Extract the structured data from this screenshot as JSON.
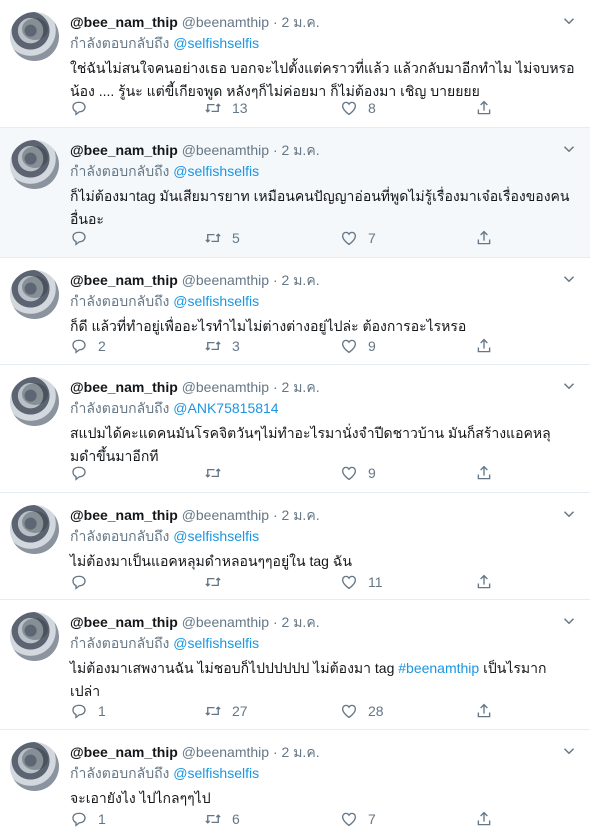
{
  "colors": {
    "link": "#1b95e0",
    "muted": "#657786",
    "text": "#14171a",
    "alt_bg": "#f5f8fa"
  },
  "tweets": [
    {
      "name": "@bee_nam_thip",
      "handle": "@beenamthip",
      "sep": "·",
      "date": "2 ม.ค.",
      "reply_prefix": "กำลังตอบกลับถึง",
      "reply_to": "@selfishselfis",
      "text": "ใช่ฉันไม่สนใจคนอย่างเธอ บอกจะไปตั้งแต่คราวที่แล้ว แล้วกลับมาอีกทำไม ไม่จบหรอ น้อง .... รู้นะ แต่ขี้เกียจพูด หลังๆก็ไม่ค่อยมา ก็ไม่ต้องมา เชิญ บายยยย",
      "replies": "",
      "retweets": "13",
      "likes": "8"
    },
    {
      "name": "@bee_nam_thip",
      "handle": "@beenamthip",
      "sep": "·",
      "date": "2 ม.ค.",
      "reply_prefix": "กำลังตอบกลับถึง",
      "reply_to": "@selfishselfis",
      "text": "ก็ไม่ต้องมาtag มันเสียมารยาท เหมือนคนปัญญาอ่อนที่พูดไม่รู้เรื่องมาเจ๋อเรื่องของคนอื่นอะ",
      "replies": "",
      "retweets": "5",
      "likes": "7"
    },
    {
      "name": "@bee_nam_thip",
      "handle": "@beenamthip",
      "sep": "·",
      "date": "2 ม.ค.",
      "reply_prefix": "กำลังตอบกลับถึง",
      "reply_to": "@selfishselfis",
      "text": "ก็ดี แล้วที่ทำอยู่เพื่ออะไรทำไมไม่ต่างต่างอยู่ไปล่ะ ต้องการอะไรหรอ",
      "replies": "2",
      "retweets": "3",
      "likes": "9"
    },
    {
      "name": "@bee_nam_thip",
      "handle": "@beenamthip",
      "sep": "·",
      "date": "2 ม.ค.",
      "reply_prefix": "กำลังตอบกลับถึง",
      "reply_to": "@ANK75815814",
      "text": "สแปมได้คะแดคนมันโรคจิตวันๆไม่ทำอะไรมานั่งจำปีดชาวบ้าน มันก็สร้างแอคหลุมดำขึ้นมาอีกที",
      "replies": "",
      "retweets": "",
      "likes": "9"
    },
    {
      "name": "@bee_nam_thip",
      "handle": "@beenamthip",
      "sep": "·",
      "date": "2 ม.ค.",
      "reply_prefix": "กำลังตอบกลับถึง",
      "reply_to": "@selfishselfis",
      "text": "ไม่ต้องมาเป็นแอคหลุมดำหลอนๆๆอยู่ใน tag ฉัน",
      "replies": "",
      "retweets": "",
      "likes": "11"
    },
    {
      "name": "@bee_nam_thip",
      "handle": "@beenamthip",
      "sep": "·",
      "date": "2 ม.ค.",
      "reply_prefix": "กำลังตอบกลับถึง",
      "reply_to": "@selfishselfis",
      "text_before": "ไม่ต้องมาเสพงานฉัน ไม่ชอบก็ไปปปปปป ไม่ต้องมา tag ",
      "hashtag": "#beenamthip",
      "text_after": " เป็นไรมากเปล่า",
      "replies": "1",
      "retweets": "27",
      "likes": "28"
    },
    {
      "name": "@bee_nam_thip",
      "handle": "@beenamthip",
      "sep": "·",
      "date": "2 ม.ค.",
      "reply_prefix": "กำลังตอบกลับถึง",
      "reply_to": "@selfishselfis",
      "text": "จะเอายังไง ไปไกลๆๆไป",
      "replies": "1",
      "retweets": "6",
      "likes": "7"
    }
  ],
  "icons": {
    "reply": "reply-icon",
    "retweet": "retweet-icon",
    "like": "heart-icon",
    "share": "share-icon",
    "caret": "chevron-down-icon"
  }
}
